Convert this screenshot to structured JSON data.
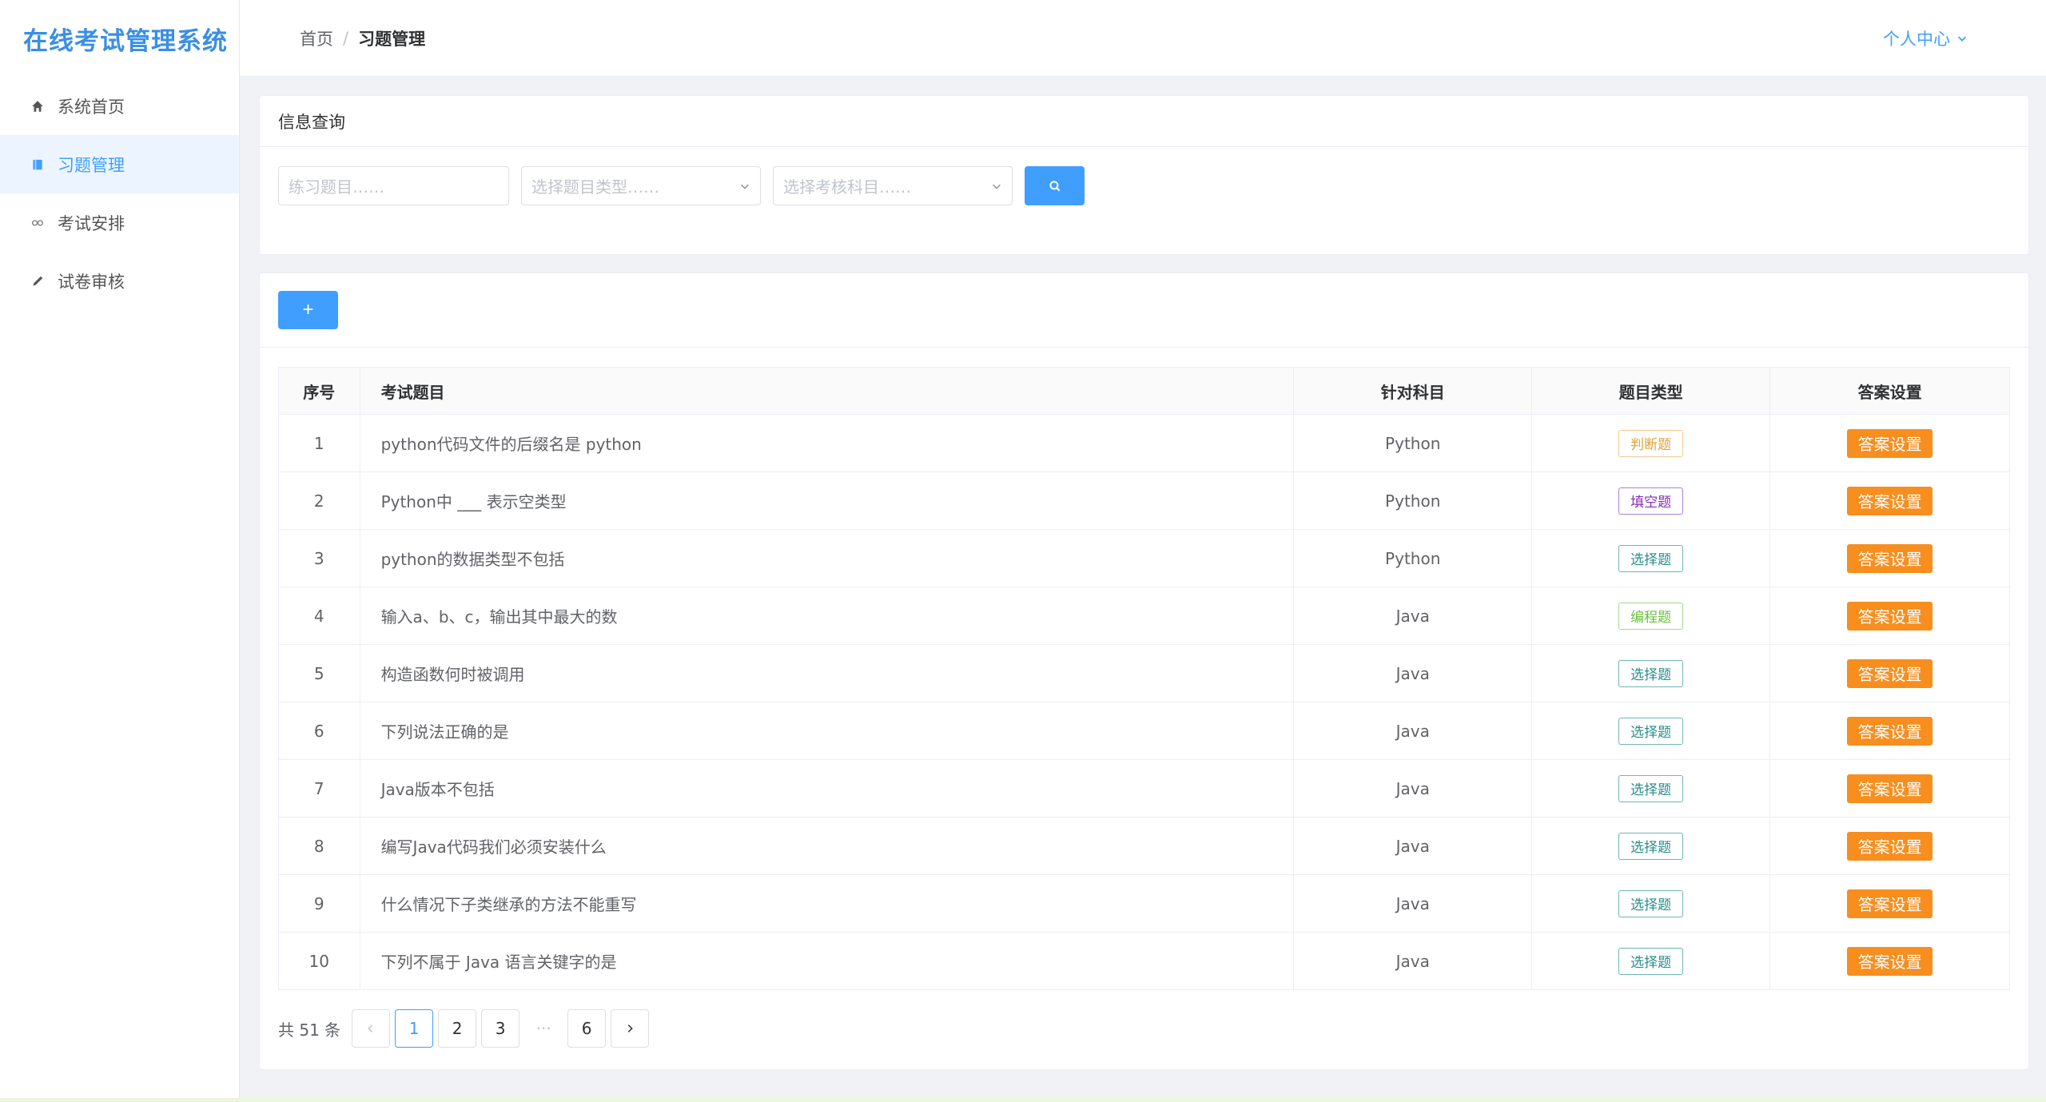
{
  "sidebar": {
    "brand": "在线考试管理系统",
    "items": [
      {
        "label": "系统首页",
        "icon": "home-icon"
      },
      {
        "label": "习题管理",
        "icon": "book-icon"
      },
      {
        "label": "考试安排",
        "icon": "infinity-icon"
      },
      {
        "label": "试卷审核",
        "icon": "pencil-icon"
      }
    ]
  },
  "header": {
    "breadcrumb": {
      "home": "首页",
      "sep": "/",
      "current": "习题管理"
    },
    "user_center": "个人中心"
  },
  "query": {
    "title": "信息查询",
    "title_placeholder": "练习题目……",
    "type_placeholder": "选择题目类型……",
    "subject_placeholder": "选择考核科目……"
  },
  "list": {
    "add_label": "+",
    "headers": {
      "idx": "序号",
      "title": "考试题目",
      "subject": "针对科目",
      "type": "题目类型",
      "answer": "答案设置"
    },
    "rows": [
      {
        "idx": "1",
        "title": "python代码文件的后缀名是 python",
        "subject": "Python",
        "type": "判断题",
        "answer": "答案设置"
      },
      {
        "idx": "2",
        "title": "Python中 ___ 表示空类型",
        "subject": "Python",
        "type": "填空题",
        "answer": "答案设置"
      },
      {
        "idx": "3",
        "title": "python的数据类型不包括",
        "subject": "Python",
        "type": "选择题",
        "answer": "答案设置"
      },
      {
        "idx": "4",
        "title": "输入a、b、c，输出其中最大的数",
        "subject": "Java",
        "type": "编程题",
        "answer": "答案设置"
      },
      {
        "idx": "5",
        "title": "构造函数何时被调用",
        "subject": "Java",
        "type": "选择题",
        "answer": "答案设置"
      },
      {
        "idx": "6",
        "title": "下列说法正确的是",
        "subject": "Java",
        "type": "选择题",
        "answer": "答案设置"
      },
      {
        "idx": "7",
        "title": "Java版本不包括",
        "subject": "Java",
        "type": "选择题",
        "answer": "答案设置"
      },
      {
        "idx": "8",
        "title": "编写Java代码我们必须安装什么",
        "subject": "Java",
        "type": "选择题",
        "answer": "答案设置"
      },
      {
        "idx": "9",
        "title": "什么情况下子类继承的方法不能重写",
        "subject": "Java",
        "type": "选择题",
        "answer": "答案设置"
      },
      {
        "idx": "10",
        "title": "下列不属于 Java 语言关键字的是",
        "subject": "Java",
        "type": "选择题",
        "answer": "答案设置"
      }
    ]
  },
  "pager": {
    "total": "共 51 条",
    "pages": [
      "1",
      "2",
      "3",
      "···",
      "6"
    ],
    "active": "1"
  },
  "colors": {
    "primary": "#409eff",
    "answer_button": "#f78e1e"
  }
}
